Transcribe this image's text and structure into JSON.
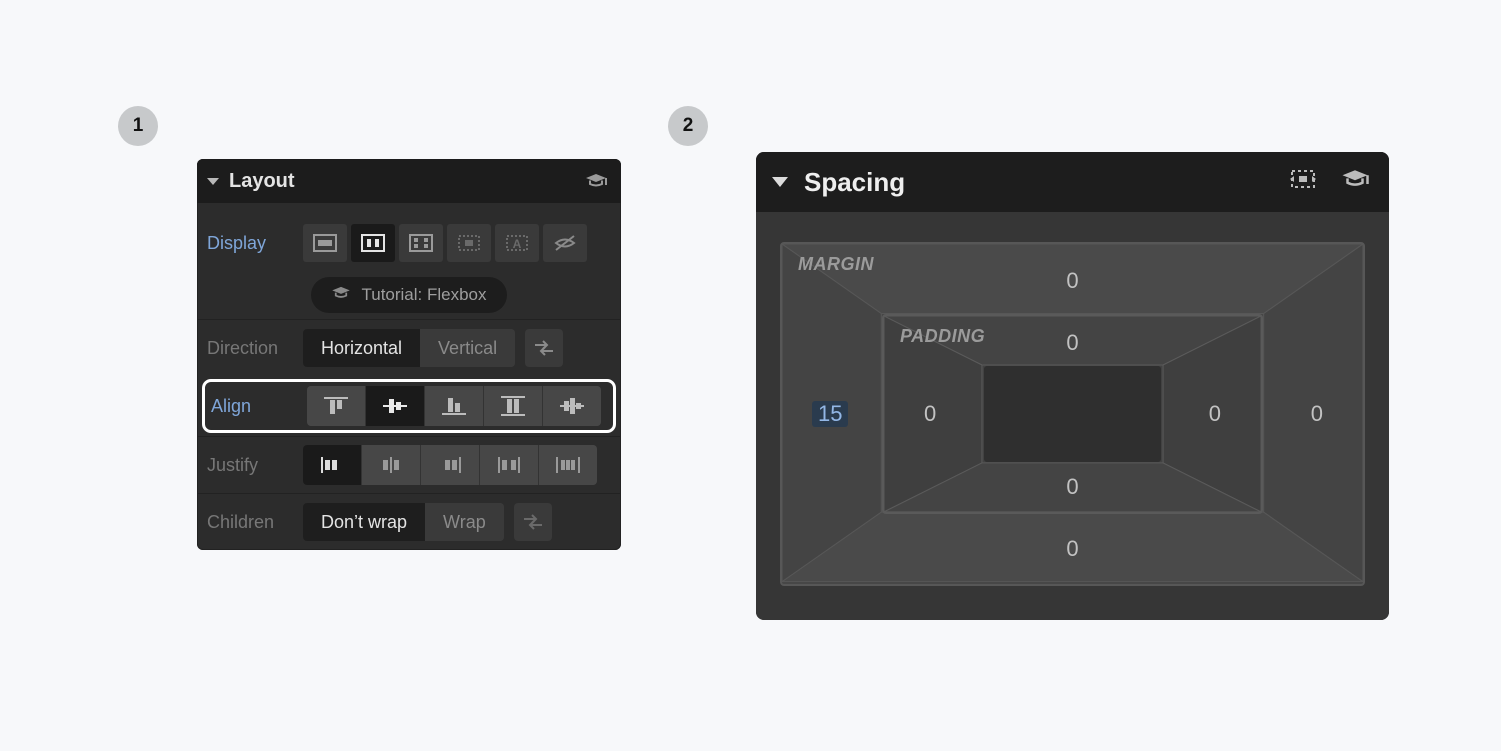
{
  "steps": {
    "one": "1",
    "two": "2"
  },
  "layout": {
    "title": "Layout",
    "display_label": "Display",
    "tutorial_label": "Tutorial: Flexbox",
    "direction_label": "Direction",
    "direction_opts": {
      "horizontal": "Horizontal",
      "vertical": "Vertical"
    },
    "align_label": "Align",
    "justify_label": "Justify",
    "children_label": "Children",
    "children_opts": {
      "nowrap": "Don’t wrap",
      "wrap": "Wrap"
    }
  },
  "spacing": {
    "title": "Spacing",
    "margin_label": "MARGIN",
    "padding_label": "PADDING",
    "margin": {
      "top": "0",
      "right": "0",
      "bottom": "0",
      "left": "15"
    },
    "padding": {
      "top": "0",
      "right": "0",
      "bottom": "0",
      "left": "0"
    }
  }
}
